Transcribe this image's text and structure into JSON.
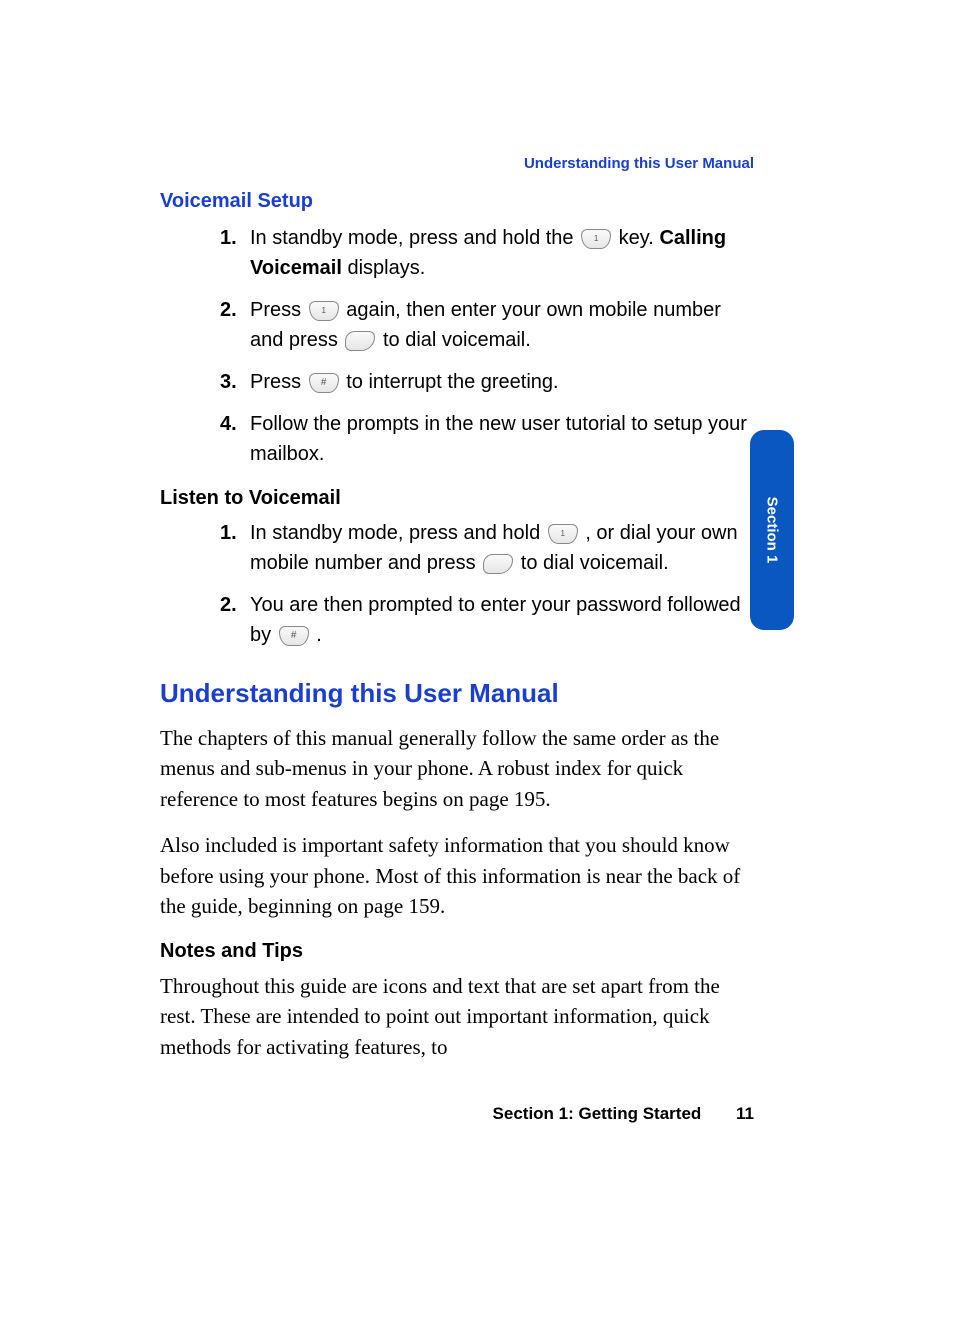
{
  "running_head": "Understanding this User Manual",
  "side_tab": "Section 1",
  "footer": {
    "section": "Section 1: Getting Started",
    "page": "11"
  },
  "h1": "Voicemail Setup",
  "setup_steps": {
    "s1a": "In standby mode, press and hold the ",
    "s1b": " key. ",
    "s1c": "Calling Voicemail",
    "s1d": " displays.",
    "s2a": "Press ",
    "s2b": " again, then enter your own mobile number and press ",
    "s2c": " to dial voicemail.",
    "s3a": "Press ",
    "s3b": " to interrupt the greeting.",
    "s4": "Follow the prompts in the new user tutorial to setup your mailbox."
  },
  "h2": "Listen to Voicemail",
  "listen_steps": {
    "s1a": "In standby mode, press and hold ",
    "s1b": ", or dial your own mobile number and press ",
    "s1c": " to dial voicemail.",
    "s2a": "You are then prompted to enter your password followed by ",
    "s2b": " ."
  },
  "h3": "Understanding this User Manual",
  "para1": "The chapters of this manual generally follow the same order as the menus and sub-menus in your phone. A robust index for quick reference to most features begins on page 195.",
  "para2": "Also included is important safety information that you should know before using your phone. Most of this information is near the back of the guide, beginning on page 159.",
  "h4": "Notes and Tips",
  "para3": "Throughout this guide are icons and text that are set apart from the rest. These are intended to point out important information, quick methods for activating features, to"
}
